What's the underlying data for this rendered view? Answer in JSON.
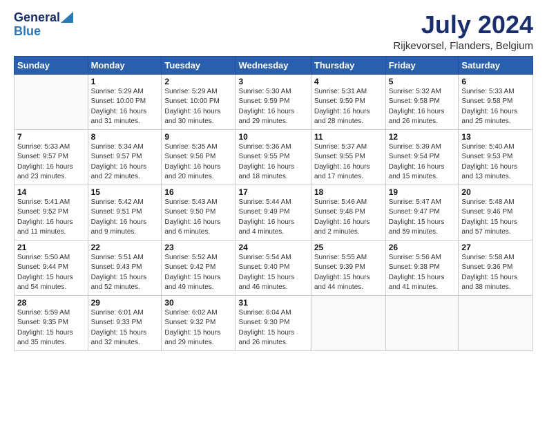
{
  "logo": {
    "general": "General",
    "blue": "Blue"
  },
  "title": {
    "month_year": "July 2024",
    "location": "Rijkevorsel, Flanders, Belgium"
  },
  "days_of_week": [
    "Sunday",
    "Monday",
    "Tuesday",
    "Wednesday",
    "Thursday",
    "Friday",
    "Saturday"
  ],
  "weeks": [
    [
      {
        "day": "",
        "info": ""
      },
      {
        "day": "1",
        "info": "Sunrise: 5:29 AM\nSunset: 10:00 PM\nDaylight: 16 hours\nand 31 minutes."
      },
      {
        "day": "2",
        "info": "Sunrise: 5:29 AM\nSunset: 10:00 PM\nDaylight: 16 hours\nand 30 minutes."
      },
      {
        "day": "3",
        "info": "Sunrise: 5:30 AM\nSunset: 9:59 PM\nDaylight: 16 hours\nand 29 minutes."
      },
      {
        "day": "4",
        "info": "Sunrise: 5:31 AM\nSunset: 9:59 PM\nDaylight: 16 hours\nand 28 minutes."
      },
      {
        "day": "5",
        "info": "Sunrise: 5:32 AM\nSunset: 9:58 PM\nDaylight: 16 hours\nand 26 minutes."
      },
      {
        "day": "6",
        "info": "Sunrise: 5:33 AM\nSunset: 9:58 PM\nDaylight: 16 hours\nand 25 minutes."
      }
    ],
    [
      {
        "day": "7",
        "info": "Sunrise: 5:33 AM\nSunset: 9:57 PM\nDaylight: 16 hours\nand 23 minutes."
      },
      {
        "day": "8",
        "info": "Sunrise: 5:34 AM\nSunset: 9:57 PM\nDaylight: 16 hours\nand 22 minutes."
      },
      {
        "day": "9",
        "info": "Sunrise: 5:35 AM\nSunset: 9:56 PM\nDaylight: 16 hours\nand 20 minutes."
      },
      {
        "day": "10",
        "info": "Sunrise: 5:36 AM\nSunset: 9:55 PM\nDaylight: 16 hours\nand 18 minutes."
      },
      {
        "day": "11",
        "info": "Sunrise: 5:37 AM\nSunset: 9:55 PM\nDaylight: 16 hours\nand 17 minutes."
      },
      {
        "day": "12",
        "info": "Sunrise: 5:39 AM\nSunset: 9:54 PM\nDaylight: 16 hours\nand 15 minutes."
      },
      {
        "day": "13",
        "info": "Sunrise: 5:40 AM\nSunset: 9:53 PM\nDaylight: 16 hours\nand 13 minutes."
      }
    ],
    [
      {
        "day": "14",
        "info": "Sunrise: 5:41 AM\nSunset: 9:52 PM\nDaylight: 16 hours\nand 11 minutes."
      },
      {
        "day": "15",
        "info": "Sunrise: 5:42 AM\nSunset: 9:51 PM\nDaylight: 16 hours\nand 9 minutes."
      },
      {
        "day": "16",
        "info": "Sunrise: 5:43 AM\nSunset: 9:50 PM\nDaylight: 16 hours\nand 6 minutes."
      },
      {
        "day": "17",
        "info": "Sunrise: 5:44 AM\nSunset: 9:49 PM\nDaylight: 16 hours\nand 4 minutes."
      },
      {
        "day": "18",
        "info": "Sunrise: 5:46 AM\nSunset: 9:48 PM\nDaylight: 16 hours\nand 2 minutes."
      },
      {
        "day": "19",
        "info": "Sunrise: 5:47 AM\nSunset: 9:47 PM\nDaylight: 15 hours\nand 59 minutes."
      },
      {
        "day": "20",
        "info": "Sunrise: 5:48 AM\nSunset: 9:46 PM\nDaylight: 15 hours\nand 57 minutes."
      }
    ],
    [
      {
        "day": "21",
        "info": "Sunrise: 5:50 AM\nSunset: 9:44 PM\nDaylight: 15 hours\nand 54 minutes."
      },
      {
        "day": "22",
        "info": "Sunrise: 5:51 AM\nSunset: 9:43 PM\nDaylight: 15 hours\nand 52 minutes."
      },
      {
        "day": "23",
        "info": "Sunrise: 5:52 AM\nSunset: 9:42 PM\nDaylight: 15 hours\nand 49 minutes."
      },
      {
        "day": "24",
        "info": "Sunrise: 5:54 AM\nSunset: 9:40 PM\nDaylight: 15 hours\nand 46 minutes."
      },
      {
        "day": "25",
        "info": "Sunrise: 5:55 AM\nSunset: 9:39 PM\nDaylight: 15 hours\nand 44 minutes."
      },
      {
        "day": "26",
        "info": "Sunrise: 5:56 AM\nSunset: 9:38 PM\nDaylight: 15 hours\nand 41 minutes."
      },
      {
        "day": "27",
        "info": "Sunrise: 5:58 AM\nSunset: 9:36 PM\nDaylight: 15 hours\nand 38 minutes."
      }
    ],
    [
      {
        "day": "28",
        "info": "Sunrise: 5:59 AM\nSunset: 9:35 PM\nDaylight: 15 hours\nand 35 minutes."
      },
      {
        "day": "29",
        "info": "Sunrise: 6:01 AM\nSunset: 9:33 PM\nDaylight: 15 hours\nand 32 minutes."
      },
      {
        "day": "30",
        "info": "Sunrise: 6:02 AM\nSunset: 9:32 PM\nDaylight: 15 hours\nand 29 minutes."
      },
      {
        "day": "31",
        "info": "Sunrise: 6:04 AM\nSunset: 9:30 PM\nDaylight: 15 hours\nand 26 minutes."
      },
      {
        "day": "",
        "info": ""
      },
      {
        "day": "",
        "info": ""
      },
      {
        "day": "",
        "info": ""
      }
    ]
  ]
}
